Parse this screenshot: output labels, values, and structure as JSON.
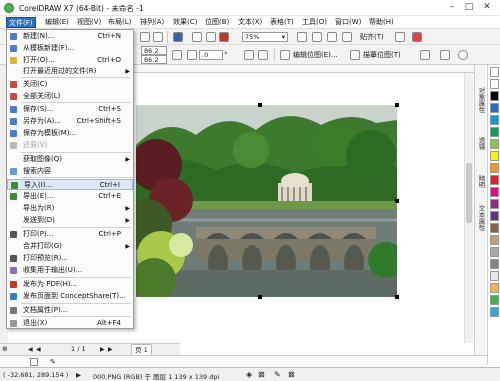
{
  "window": {
    "title": "CorelDRAW X7 (64-Bit) - 未命名 -1",
    "minimize": "–",
    "maximize": "□",
    "close": "✕"
  },
  "menubar": [
    {
      "label": "文件(F)",
      "active": true
    },
    {
      "label": "编辑(E)"
    },
    {
      "label": "视图(V)"
    },
    {
      "label": "布局(L)"
    },
    {
      "label": "排列(A)"
    },
    {
      "label": "效果(C)"
    },
    {
      "label": "位图(B)"
    },
    {
      "label": "文本(X)"
    },
    {
      "label": "表格(T)"
    },
    {
      "label": "工具(O)"
    },
    {
      "label": "窗口(W)"
    },
    {
      "label": "帮助(H)"
    }
  ],
  "toolbar": {
    "zoom": "75%",
    "snap_label": "贴齐(T)",
    "width_value": "86.2",
    "height_value": "86.2",
    "rotation_value": ".0",
    "rotation_unit": "°",
    "edit_bitmap_label": "编辑位图(E)...",
    "trace_bitmap_label": "描摹位图(T)"
  },
  "file_menu": {
    "items": [
      {
        "label": "新建(N)...",
        "shortcut": "Ctrl+N",
        "icon_color": "#4a7cc7",
        "icon": "new-document-icon"
      },
      {
        "label": "从模板新建(F)...",
        "icon_color": "#4a7cc7",
        "icon": "template-icon"
      },
      {
        "label": "打开(O)...",
        "shortcut": "Ctrl+O",
        "icon_color": "#e0b030",
        "icon": "open-folder-icon"
      },
      {
        "label": "打开最近用过的文件(R)",
        "submenu": true
      },
      {
        "label": "关闭(C)",
        "icon_color": "#c94a3a",
        "icon": "close-document-icon"
      },
      {
        "label": "全部关闭(L)",
        "icon_color": "#c94a3a",
        "icon": "close-all-icon"
      },
      {
        "label": "保存(S)...",
        "shortcut": "Ctrl+S",
        "icon_color": "#4a7cc7",
        "icon": "save-icon"
      },
      {
        "label": "另存为(A)...",
        "shortcut": "Ctrl+Shift+S",
        "icon_color": "#4a7cc7",
        "icon": "save-as-icon"
      },
      {
        "label": "保存为模板(M)...",
        "icon_color": "#4a7cc7",
        "icon": "save-template-icon"
      },
      {
        "label": "还原(V)",
        "disabled": true,
        "icon_color": "#bbbbbb",
        "icon": "revert-icon"
      },
      {
        "label": "获取图像(Q)",
        "submenu": true
      },
      {
        "label": "搜索内容",
        "icon_color": "#6a9ad0",
        "icon": "search-content-icon"
      },
      {
        "label": "导入(I)...",
        "shortcut": "Ctrl+I",
        "highlighted": true,
        "icon_color": "#3a8a3a",
        "icon": "import-icon"
      },
      {
        "label": "导出(E)...",
        "shortcut": "Ctrl+E",
        "icon_color": "#3a8a3a",
        "icon": "export-icon"
      },
      {
        "label": "导出为(R)",
        "submenu": true
      },
      {
        "label": "发送到(D)",
        "submenu": true
      },
      {
        "label": "打印(P)...",
        "shortcut": "Ctrl+P",
        "icon_color": "#555555",
        "icon": "print-icon"
      },
      {
        "label": "合并打印(G)",
        "submenu": true
      },
      {
        "label": "打印预览(R)...",
        "icon_color": "#555555",
        "icon": "print-preview-icon"
      },
      {
        "label": "收集用于输出(U)...",
        "icon_color": "#8a6fbf",
        "icon": "collect-output-icon"
      },
      {
        "label": "发布为 PDF(H)...",
        "icon_color": "#c0392b",
        "icon": "pdf-icon"
      },
      {
        "label": "发布页面到 ConceptShare(T)...",
        "icon_color": "#2f7fcf",
        "icon": "conceptshare-icon"
      },
      {
        "label": "文档属性(P)...",
        "icon_color": "#777777",
        "icon": "document-properties-icon"
      },
      {
        "label": "退出(X)",
        "shortcut": "Alt+F4",
        "icon_color": "#999999",
        "icon": "exit-icon"
      }
    ]
  },
  "dockers": {
    "tab1": "对象属性",
    "tab2": "透镜",
    "tab3": "暗明",
    "tab4": "文本属性"
  },
  "palette": [
    "#ffffff",
    "#000000",
    "#1e6fd0",
    "#00a0e0",
    "#00a650",
    "#8bc53f",
    "#fff200",
    "#f7941d",
    "#ed1c24",
    "#ec008c",
    "#92278f",
    "#662d91",
    "#8c6239",
    "#c69c6d",
    "#a7a9ac",
    "#808285",
    "#e6e7e8",
    "#fbb040",
    "#39b54a",
    "#27aae1"
  ],
  "page_nav": {
    "page_count": "1 / 1",
    "page_tab": "页 1"
  },
  "status": {
    "coords": "( -32.681, 289.154 )",
    "info": "000.PNG (RGB) 于 图层 1 139 x 139 dpi"
  }
}
